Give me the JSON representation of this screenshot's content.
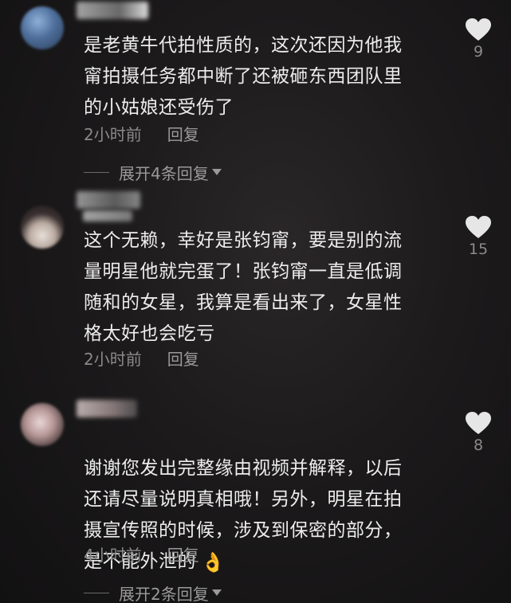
{
  "comments": [
    {
      "text": "是老黄牛代拍性质的，这次还因为他我\n甯拍摄任务都中断了还被砸东西团队里\n的小姑娘还受伤了",
      "time": "2小时前",
      "reply": "回复",
      "likes": "9",
      "expand": "展开4条回复"
    },
    {
      "text": "这个无赖，幸好是张钧甯，要是别的流\n量明星他就完蛋了！张钧甯一直是低调\n随和的女星，我算是看出来了，女星性\n格太好也会吃亏",
      "time": "2小时前",
      "reply": "回复",
      "likes": "15"
    },
    {
      "text": "谢谢您发出完整缘由视频并解释，以后\n还请尽量说明真相哦！另外，明星在拍\n摄宣传照的时候，涉及到保密的部分，\n是不能外泄的",
      "emoji": "👌",
      "time": "4小时前",
      "reply": "回复",
      "likes": "8",
      "expand": "展开2条回复"
    }
  ],
  "icons": {
    "like": "heart-icon",
    "expand": "caret-down-icon"
  },
  "colors": {
    "background": "#1c1a1b",
    "text": "#ededed",
    "meta": "#8a8a8a",
    "heart": "#e6e6e6"
  }
}
